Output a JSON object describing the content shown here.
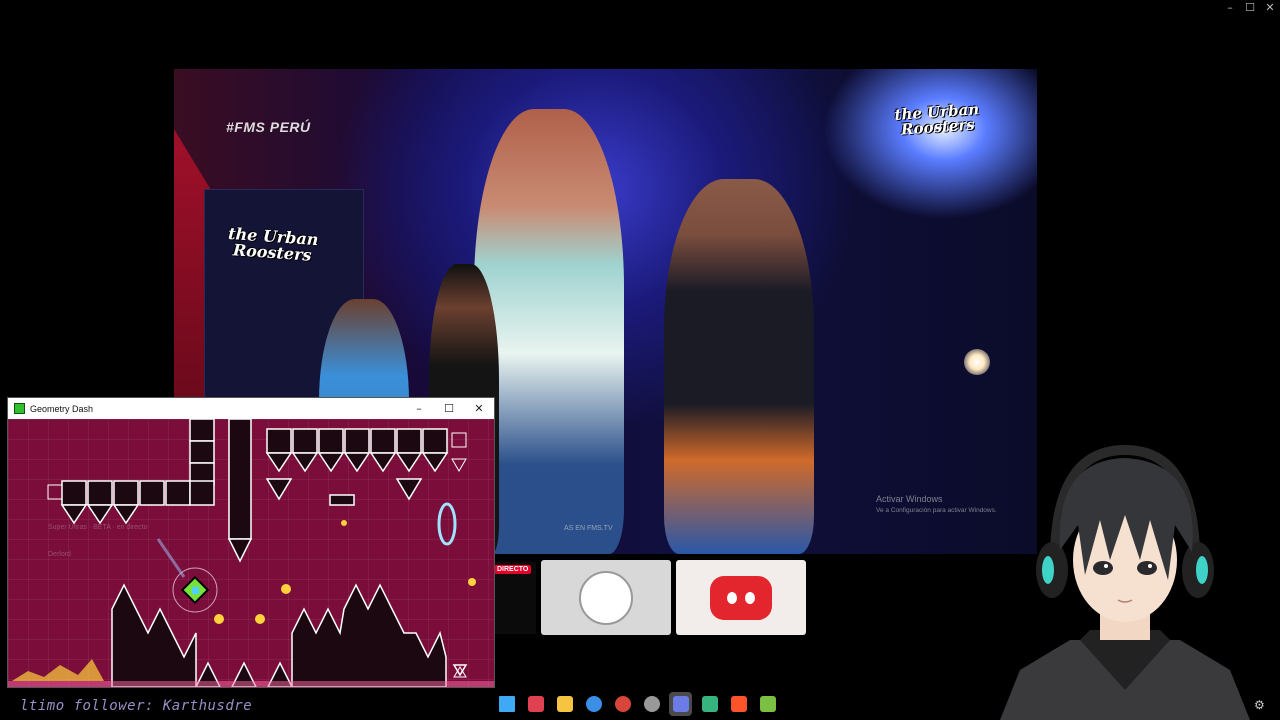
{
  "window": {
    "controls": [
      "–",
      "☐",
      "✕"
    ]
  },
  "video": {
    "tag": "#FMS PERÚ",
    "logo_right": "the Urban Roosters",
    "logo_left": "the Urban Roosters",
    "footer_text": "AS EN FMS.TV",
    "watermark_title": "Activar Windows",
    "watermark_sub": "Ve a Configuración para activar Windows."
  },
  "live_badge": "DIRECTO",
  "gd_window": {
    "title": "Geometry Dash",
    "controls": [
      "–",
      "☐",
      "✕"
    ],
    "overlay_line1": "Super Ultras · BETA · en directo",
    "overlay_line2": "Derlord"
  },
  "follower_text": "ltimo follower: Karthusdre",
  "taskbar": {
    "icons": [
      {
        "name": "start-icon",
        "color": "#3fa9f5"
      },
      {
        "name": "app-vivaldi-icon",
        "color": "#e04050"
      },
      {
        "name": "folder-icon",
        "color": "#f5c542"
      },
      {
        "name": "chrome-icon",
        "color": "#3a8ee6"
      },
      {
        "name": "chrome-alt-icon",
        "color": "#d8453a"
      },
      {
        "name": "obs-icon",
        "color": "#999999"
      },
      {
        "name": "discord-icon",
        "color": "#6c7ce7"
      },
      {
        "name": "app-green-icon",
        "color": "#36b37e"
      },
      {
        "name": "brave-icon",
        "color": "#fb542b"
      },
      {
        "name": "geometry-dash-icon",
        "color": "#7bc043"
      }
    ],
    "active_index": 6
  },
  "colors": {
    "gd_bg": "#7a0d3a",
    "follower": "#9b8ec4",
    "live_red": "#e4002b",
    "discord_red": "#e3262d"
  }
}
